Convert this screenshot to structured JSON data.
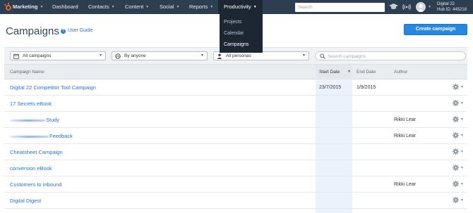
{
  "topnav": {
    "brand": "Marketing",
    "items": [
      {
        "label": "Dashboard"
      },
      {
        "label": "Contacts"
      },
      {
        "label": "Content"
      },
      {
        "label": "Social"
      },
      {
        "label": "Reports"
      },
      {
        "label": "Productivity"
      }
    ],
    "search_placeholder": "Search",
    "portal_name": "Digital 22",
    "hub_id": "Hub ID: 445218"
  },
  "productivity_menu": {
    "items": [
      "Projects",
      "Calendar",
      "Campaigns"
    ],
    "selected": "Campaigns"
  },
  "header": {
    "title": "Campaigns",
    "user_guide": "User Guide",
    "create_button": "Create campaign"
  },
  "filters": {
    "campaigns": "All campaigns",
    "owner": "By anyone",
    "personas": "All personas",
    "search_placeholder": "Search campaigns"
  },
  "table": {
    "columns": {
      "name": "Campaign Name",
      "start": "Start Date",
      "end": "End Date",
      "author": "Author"
    },
    "rows": [
      {
        "name": "Digital 22 Competitor Tool Campaign",
        "start": "23/7/2015",
        "end": "1/9/2015",
        "author": ""
      },
      {
        "name": "17 Secrets eBook",
        "start": "",
        "end": "",
        "author": ""
      },
      {
        "name": "Study",
        "start": "",
        "end": "",
        "author": "Rikki Lear",
        "redacted": true
      },
      {
        "name": "Feedback",
        "start": "",
        "end": "",
        "author": "Rikki Lear",
        "redacted": true
      },
      {
        "name": "Cheatsheet Campaign",
        "start": "",
        "end": "",
        "author": ""
      },
      {
        "name": "conversion eBook",
        "start": "",
        "end": "",
        "author": ""
      },
      {
        "name": "Customers to inbound",
        "start": "",
        "end": "",
        "author": "Rikki Lear"
      },
      {
        "name": "Digital Digest",
        "start": "",
        "end": "",
        "author": ""
      }
    ]
  },
  "colors": {
    "nav_bg": "#2d3e50",
    "accent": "#2a87e0",
    "link": "#2a6fdb",
    "logo": "#f57722"
  }
}
